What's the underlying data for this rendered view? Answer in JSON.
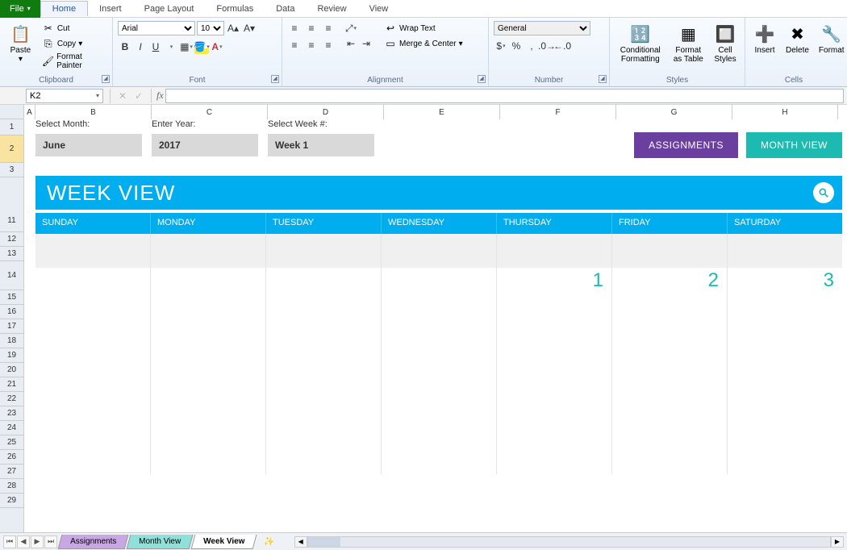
{
  "ribbon": {
    "file": "File",
    "tabs": [
      "Home",
      "Insert",
      "Page Layout",
      "Formulas",
      "Data",
      "Review",
      "View"
    ],
    "active_tab": "Home",
    "clipboard": {
      "paste": "Paste",
      "cut": "Cut",
      "copy": "Copy",
      "fmt": "Format Painter",
      "label": "Clipboard"
    },
    "font": {
      "name": "Arial",
      "size": "10",
      "label": "Font"
    },
    "alignment": {
      "wrap": "Wrap Text",
      "merge": "Merge & Center",
      "label": "Alignment"
    },
    "number": {
      "format": "General",
      "label": "Number"
    },
    "styles": {
      "cond": "Conditional Formatting",
      "fmt_tbl": "Format as Table",
      "cell": "Cell Styles",
      "label": "Styles"
    },
    "cells": {
      "insert": "Insert",
      "delete": "Delete",
      "format": "Format",
      "label": "Cells"
    }
  },
  "formula_bar": {
    "name_box": "K2",
    "fx": "fx",
    "formula": ""
  },
  "columns": [
    "A",
    "B",
    "C",
    "D",
    "E",
    "F",
    "G",
    "H"
  ],
  "rows": [
    "1",
    "2",
    "3",
    "11",
    "12",
    "13",
    "14",
    "15",
    "16",
    "17",
    "18",
    "19",
    "20",
    "21",
    "22",
    "23",
    "24",
    "25",
    "26",
    "27",
    "28",
    "29"
  ],
  "template": {
    "labels": {
      "month": "Select Month:",
      "year": "Enter Year:",
      "week": "Select Week #:"
    },
    "selectors": {
      "month": "June",
      "year": "2017",
      "week": "Week 1"
    },
    "buttons": {
      "assignments": "ASSIGNMENTS",
      "month_view": "MONTH VIEW"
    },
    "title": "WEEK VIEW",
    "days": [
      "SUNDAY",
      "MONDAY",
      "TUESDAY",
      "WEDNESDAY",
      "THURSDAY",
      "FRIDAY",
      "SATURDAY"
    ],
    "dates": [
      "",
      "",
      "",
      "",
      "1",
      "2",
      "3"
    ]
  },
  "sheet_tabs": {
    "assignments": "Assignments",
    "month": "Month View",
    "week": "Week View"
  }
}
